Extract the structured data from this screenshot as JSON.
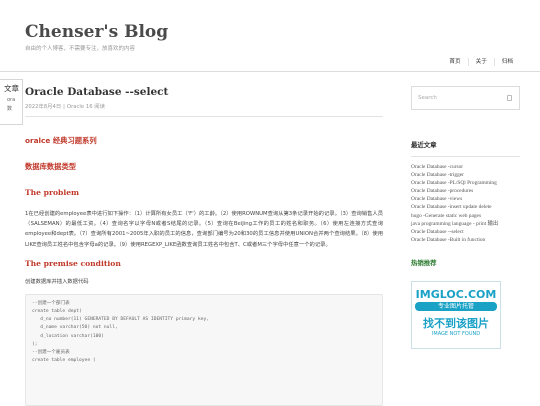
{
  "site": {
    "title": "Chenser's Blog",
    "description": "自由的个人博客，不需要专注，放喜欢的内容"
  },
  "nav": [
    "首页",
    "关于",
    "归档"
  ],
  "toc": {
    "title": "文章",
    "items": [
      "ora",
      "数"
    ]
  },
  "post": {
    "title": "Oracle Database --select",
    "date": "2022年8月4日",
    "category": "Oracle",
    "reads": "16 阅读",
    "heading_series": "oralce 经典习题系列",
    "heading_types": "数据库数据类型",
    "section_problem": "The problem",
    "problem_text": "1在已经创建的employee表中进行如下操作：（1）计算所有女员工（'F'）的工龄。（2）使用ROWNUM查询从第3条记录开始的记录。（3）查询销售人员（SALSEMAN）的最低工资。（4）查询名字以字母N或者S结尾的记录。（5）查询在BeiJing工作的员工的姓名和职务。（6）使用左连接方式查询employee和dept表。（7）查询所有2001~2005年入职的员工的信息，查询部门编号为20和30的员工信息并使用UNION合并两个查询结果。（8）使用LIKE查询员工姓名中包含字母a的记录。（9）使用REGEXP_LIKE函数查询员工姓名中包含T、C或者M三个字母中任意一个的记录。",
    "section_premise": "The premise condition",
    "premise_text": "创建数据库并插入数据代码",
    "code_lines": [
      "--创建一个部门表",
      "create table dept(",
      "   d_no number(11) GENERATED BY DEFAULT AS IDENTITY primary key,",
      "   d_name varchar(50) not null,",
      "   d_location varchar(100)",
      ");",
      "",
      "--创建一个雇员表",
      "create table employee ("
    ]
  },
  "sidebar": {
    "search_placeholder": "Search",
    "recent_title": "最近文章",
    "recent_posts": [
      "Oracle Database -cursor",
      "Oracle Database -trigger",
      "Oracle Database -PL/SQl Programming",
      "Oracle Database -procedures",
      "Oracle Database -views",
      "Oracle Database -insert update delete",
      "hugo -Generate static web pages",
      "java programming language - print 输出",
      "Oracle Database --select",
      "Oracle Database -Built in function"
    ],
    "recommend_title": "热销推荐",
    "promo": {
      "line1": "IMGLOC.COM",
      "line2": "专业图片托管",
      "line3": "找不到该图片",
      "line4": "IMAGE NOT FOUND"
    }
  },
  "colors": {
    "accent_red": "#c0392b",
    "accent_green": "#2e7d32",
    "promo_blue": "#1aa1c6"
  }
}
